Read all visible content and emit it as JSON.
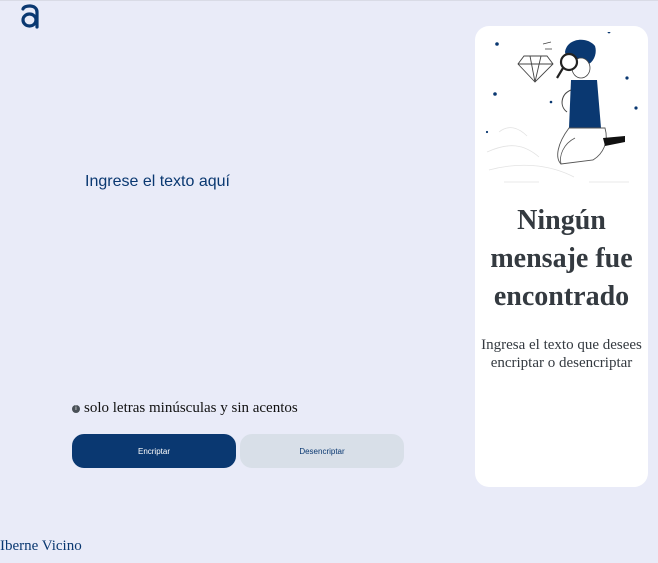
{
  "header": {
    "logo_icon": "alura-logo-icon"
  },
  "editor": {
    "placeholder": "Ingrese el texto aquí"
  },
  "hint": {
    "icon": "info-circle-icon",
    "text": "solo letras minúsculas y sin acentos"
  },
  "actions": {
    "encrypt_label": "Encriptar",
    "decrypt_label": "Desencriptar"
  },
  "result_panel": {
    "illustration": "person-with-magnifying-glass-illustration",
    "title": "Ningún mensaje fue encontrado",
    "message": "Ingresa el texto que desees encriptar o desencriptar"
  },
  "footer": {
    "author": "Iberne Vicino"
  },
  "colors": {
    "background": "#e9ebf8",
    "primary": "#0a3871",
    "secondary_button": "#d8dfe8",
    "panel": "#ffffff",
    "panel_text": "#343a40"
  }
}
